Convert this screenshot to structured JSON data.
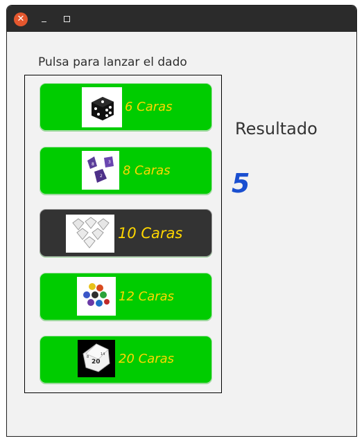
{
  "window": {
    "controls": {
      "close_icon": "close-icon",
      "minimize_icon": "minimize-icon",
      "maximize_icon": "maximize-icon"
    }
  },
  "main": {
    "prompt": "Pulsa para lanzar el dado",
    "dice": [
      {
        "label": "6 Caras",
        "icon": "d6-dice-icon",
        "active": false
      },
      {
        "label": "8 Caras",
        "icon": "d8-dice-icon",
        "active": false
      },
      {
        "label": "10 Caras",
        "icon": "d10-dice-icon",
        "active": true
      },
      {
        "label": "12 Caras",
        "icon": "d12-dice-icon",
        "active": false
      },
      {
        "label": "20 Caras",
        "icon": "d20-dice-icon",
        "active": false
      }
    ],
    "result_label": "Resultado",
    "result_value": "5"
  },
  "colors": {
    "button_green": "#00cc00",
    "button_active": "#333333",
    "label_yellow": "#ffd700",
    "result_blue": "#1a4fd0",
    "close_red": "#e4572e"
  }
}
